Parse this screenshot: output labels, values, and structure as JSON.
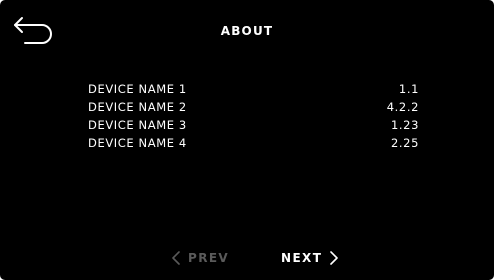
{
  "header": {
    "title": "ABOUT"
  },
  "device_info": [
    {
      "name": "DEVICE NAME 1",
      "value": "1.1"
    },
    {
      "name": "DEVICE NAME 2",
      "value": "4.2.2"
    },
    {
      "name": "DEVICE NAME 3",
      "value": "1.23"
    },
    {
      "name": "DEVICE NAME 4",
      "value": "2.25"
    }
  ],
  "pagination": {
    "prev_label": "PREV",
    "next_label": "NEXT",
    "prev_enabled": false,
    "next_enabled": true
  },
  "colors": {
    "background": "#000000",
    "text": "#ffffff",
    "disabled": "#5a5a5a"
  }
}
